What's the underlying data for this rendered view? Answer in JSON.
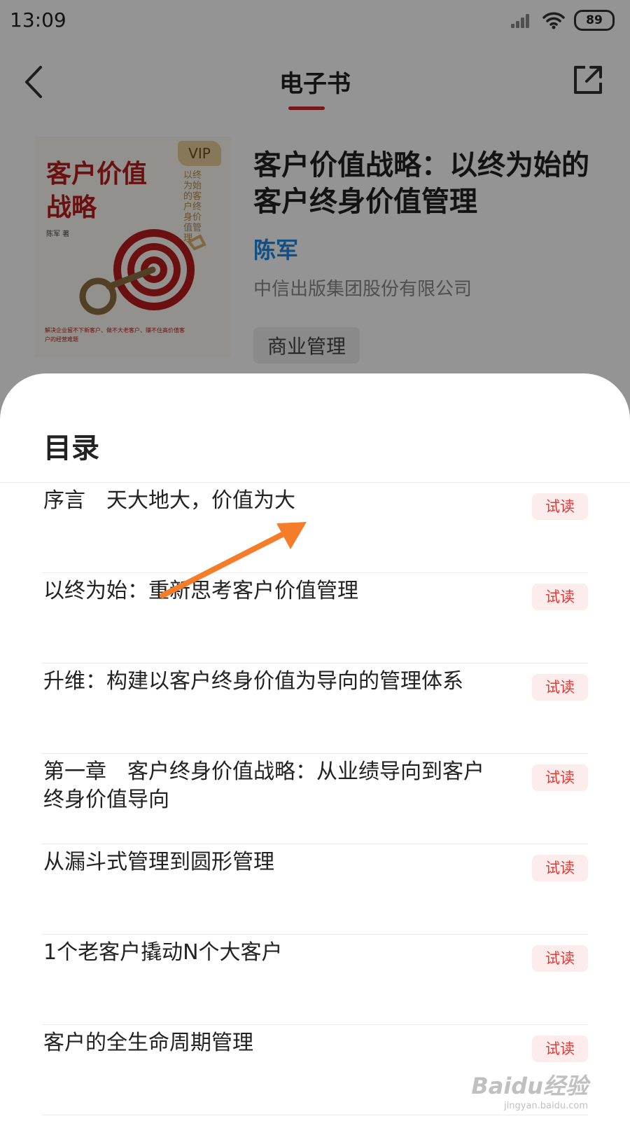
{
  "status_bar": {
    "time": "13:09",
    "battery": "89"
  },
  "nav": {
    "title": "电子书"
  },
  "book": {
    "cover": {
      "title": "客户价值战略",
      "vip": "VIP",
      "subtitle": "以终为始的客户终身价值管理",
      "author_line": "陈军 著",
      "tagline": "解决企业留不下新客户、做不大老客户、赚不住高价值客户的经营难题"
    },
    "title": "客户价值战略：以终为始的客户终身价值管理",
    "author": "陈军",
    "publisher": "中信出版集团股份有限公司",
    "tag": "商业管理"
  },
  "toc": {
    "heading": "目录",
    "trial_label": "试读",
    "items": [
      {
        "text": "序言　天大地大，价值为大"
      },
      {
        "text": "以终为始：重新思考客户价值管理"
      },
      {
        "text": "升维：构建以客户终身价值为导向的管理体系"
      },
      {
        "text": "第一章　客户终身价值战略：从业绩导向到客户终身价值导向"
      },
      {
        "text": "从漏斗式管理到圆形管理"
      },
      {
        "text": "1个老客户撬动N个大客户"
      },
      {
        "text": "客户的全生命周期管理"
      }
    ]
  },
  "watermark": {
    "logo": "Baidu经验",
    "url": "jingyan.baidu.com"
  },
  "colors": {
    "accent": "#c62828",
    "author": "#1e88e5",
    "trial_bg": "#fdecec",
    "trial_text": "#e53935",
    "annotation_arrow": "#f57c28"
  }
}
